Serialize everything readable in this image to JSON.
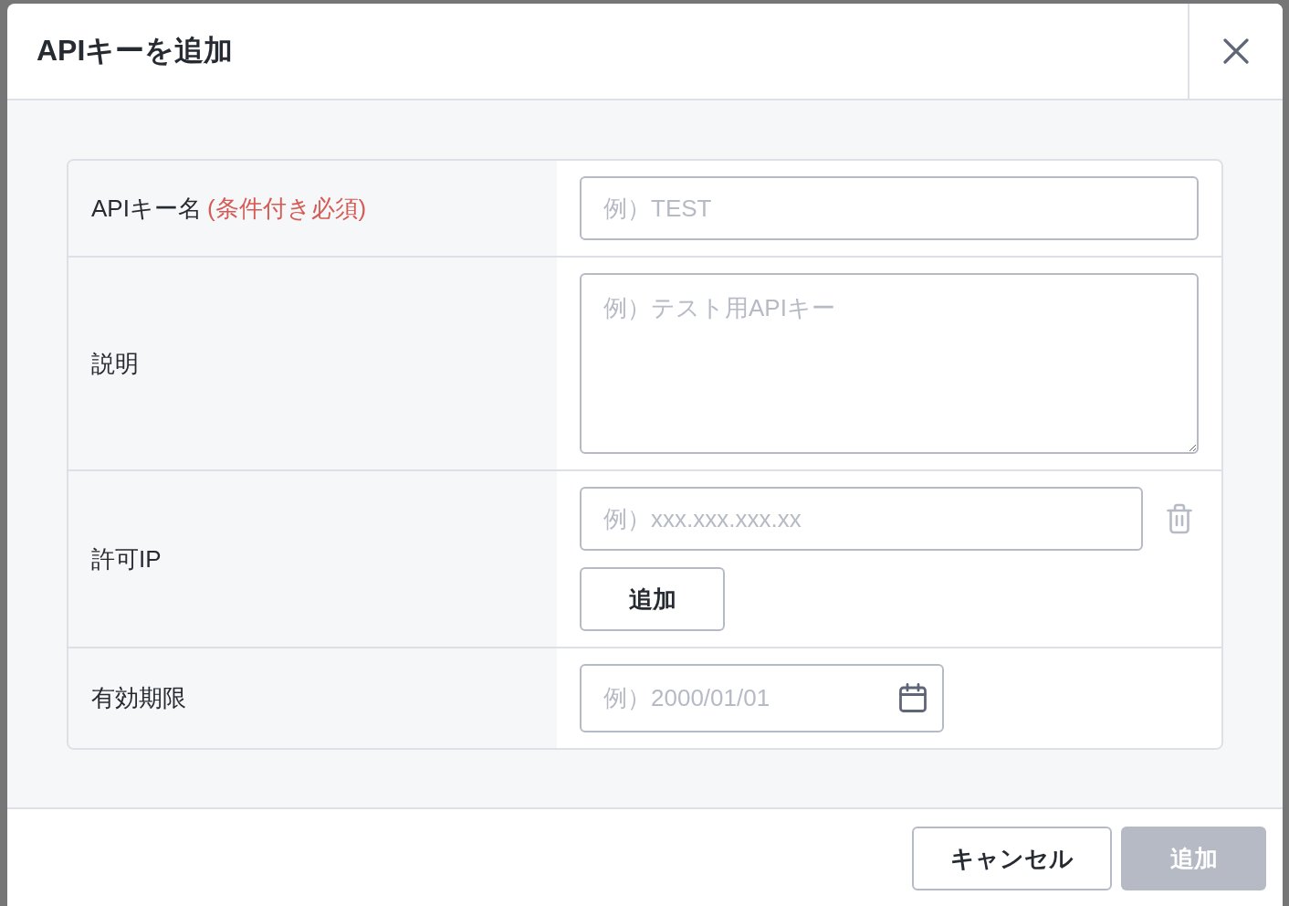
{
  "dialog": {
    "title": "APIキーを追加"
  },
  "fields": [
    {
      "kind": "text",
      "label": "APIキー名",
      "required_note": "(条件付き必須)",
      "placeholder": "例）TEST"
    },
    {
      "kind": "textarea",
      "label": "説明",
      "placeholder": "例）テスト用APIキー"
    },
    {
      "kind": "ip_list",
      "label": "許可IP",
      "entries": [
        {
          "placeholder": "例）xxx.xxx.xxx.xx"
        }
      ],
      "add_button": "追加"
    },
    {
      "kind": "date",
      "label": "有効期限",
      "placeholder": "例）2000/01/01"
    }
  ],
  "footer": {
    "buttons": [
      {
        "label": "キャンセル",
        "kind": "secondary",
        "disabled": false
      },
      {
        "label": "追加",
        "kind": "primary",
        "disabled": true
      }
    ]
  }
}
